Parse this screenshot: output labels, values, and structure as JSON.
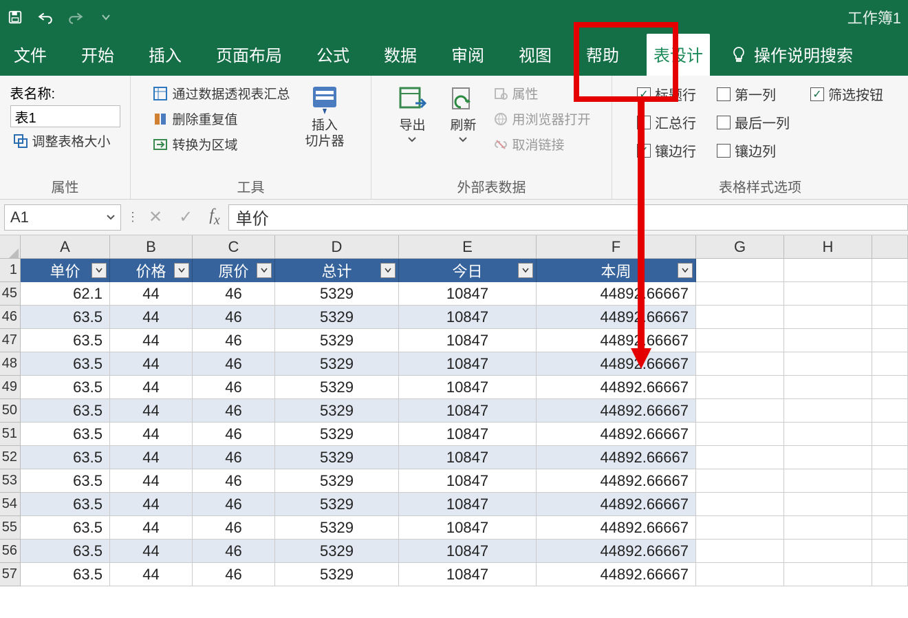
{
  "window": {
    "workbook": "工作簿1"
  },
  "tabs": {
    "file": "文件",
    "home": "开始",
    "insert": "插入",
    "layout": "页面布局",
    "formula": "公式",
    "data": "数据",
    "review": "审阅",
    "view": "视图",
    "help": "帮助",
    "tabledesign": "表设计",
    "tellme": "操作说明搜索"
  },
  "ribbon": {
    "properties": {
      "label": "属性",
      "tablename_label": "表名称:",
      "tablename_value": "表1",
      "resize": "调整表格大小"
    },
    "tools": {
      "label": "工具",
      "pivot": "通过数据透视表汇总",
      "dedup": "删除重复值",
      "convert": "转换为区域",
      "slicer_l1": "插入",
      "slicer_l2": "切片器"
    },
    "external": {
      "label": "外部表数据",
      "export": "导出",
      "refresh": "刷新",
      "props": "属性",
      "openbrowser": "用浏览器打开",
      "unlink": "取消链接"
    },
    "styleopts": {
      "label": "表格样式选项",
      "headerrow": "标题行",
      "totalrow": "汇总行",
      "bandedrows": "镶边行",
      "firstcol": "第一列",
      "lastcol": "最后一列",
      "bandedcols": "镶边列",
      "filterbtn": "筛选按钮"
    }
  },
  "namebox": "A1",
  "fx_value": "单价",
  "columns": {
    "A": "A",
    "B": "B",
    "C": "C",
    "D": "D",
    "E": "E",
    "F": "F",
    "G": "G",
    "H": "H"
  },
  "headers": {
    "A": "单价",
    "B": "价格",
    "C": "原价",
    "D": "总计",
    "E": "今日",
    "F": "本周"
  },
  "row_numbers": [
    "1",
    "45",
    "46",
    "47",
    "48",
    "49",
    "50",
    "51",
    "52",
    "53",
    "54",
    "55",
    "56",
    "57"
  ],
  "rows": [
    {
      "A": "62.1",
      "B": "44",
      "C": "46",
      "D": "5329",
      "E": "10847",
      "F": "44892.66667"
    },
    {
      "A": "63.5",
      "B": "44",
      "C": "46",
      "D": "5329",
      "E": "10847",
      "F": "44892.66667"
    },
    {
      "A": "63.5",
      "B": "44",
      "C": "46",
      "D": "5329",
      "E": "10847",
      "F": "44892.66667"
    },
    {
      "A": "63.5",
      "B": "44",
      "C": "46",
      "D": "5329",
      "E": "10847",
      "F": "44892.66667"
    },
    {
      "A": "63.5",
      "B": "44",
      "C": "46",
      "D": "5329",
      "E": "10847",
      "F": "44892.66667"
    },
    {
      "A": "63.5",
      "B": "44",
      "C": "46",
      "D": "5329",
      "E": "10847",
      "F": "44892.66667"
    },
    {
      "A": "63.5",
      "B": "44",
      "C": "46",
      "D": "5329",
      "E": "10847",
      "F": "44892.66667"
    },
    {
      "A": "63.5",
      "B": "44",
      "C": "46",
      "D": "5329",
      "E": "10847",
      "F": "44892.66667"
    },
    {
      "A": "63.5",
      "B": "44",
      "C": "46",
      "D": "5329",
      "E": "10847",
      "F": "44892.66667"
    },
    {
      "A": "63.5",
      "B": "44",
      "C": "46",
      "D": "5329",
      "E": "10847",
      "F": "44892.66667"
    },
    {
      "A": "63.5",
      "B": "44",
      "C": "46",
      "D": "5329",
      "E": "10847",
      "F": "44892.66667"
    },
    {
      "A": "63.5",
      "B": "44",
      "C": "46",
      "D": "5329",
      "E": "10847",
      "F": "44892.66667"
    },
    {
      "A": "63.5",
      "B": "44",
      "C": "46",
      "D": "5329",
      "E": "10847",
      "F": "44892.66667"
    }
  ]
}
